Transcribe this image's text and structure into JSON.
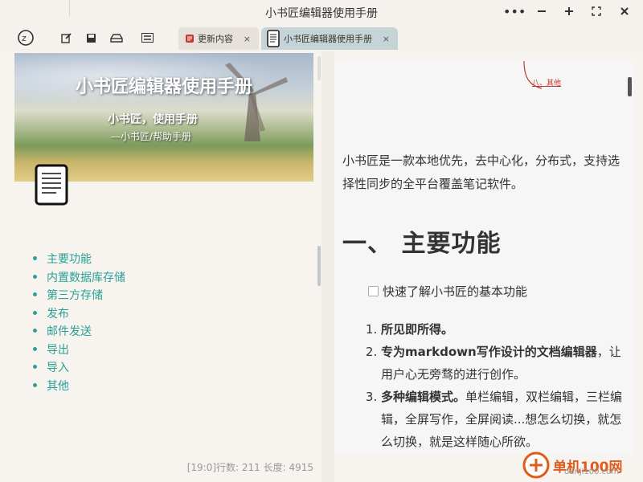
{
  "window": {
    "title": "小书匠编辑器使用手册",
    "controls": [
      "more",
      "minimize",
      "maximize",
      "fullscreen",
      "close"
    ]
  },
  "toolbar": {
    "icons": [
      "app-logo",
      "edit",
      "save",
      "disk",
      "menu"
    ],
    "tabs": [
      {
        "label": "更新内容",
        "close": "×",
        "active": false
      },
      {
        "label": "小书匠编辑器使用手册",
        "close": "×",
        "active": true
      }
    ]
  },
  "left_pane": {
    "banner": {
      "title": "小书匠编辑器使用手册",
      "subtitle": "小书匠，使用手册",
      "sub2": "—小书匠/帮助手册"
    },
    "outline": [
      "主要功能",
      "内置数据库存储",
      "第三方存储",
      "发布",
      "邮件发送",
      "导出",
      "导入",
      "其他"
    ],
    "status": "[19:0]行数: 211 长度: 4915"
  },
  "right_pane": {
    "top_link": "八、其他",
    "intro": "小书匠是一款本地优先，去中心化，分布式，支持选择性同步的全平台覆盖笔记软件。",
    "heading": "一、  主要功能",
    "checkbox_label": "快速了解小书匠的基本功能",
    "list": [
      {
        "bold": "所见即所得。",
        "text": ""
      },
      {
        "bold": "专为markdown写作设计的文档编辑器",
        "text": "，让用户心无旁骛的进行创作。"
      },
      {
        "bold": "多种编辑模式。",
        "text": "单栏编辑，双栏编辑，三栏编辑，全屏写作，全屏阅读...想怎么切换，就怎么切换，就是这样随心所欲。"
      }
    ]
  },
  "watermark": {
    "text": "单机100网",
    "sub": "danji100.com"
  },
  "colors": {
    "accent": "#2aa198",
    "background": "#f7f3ee",
    "active_tab": "#c6d4d7"
  }
}
